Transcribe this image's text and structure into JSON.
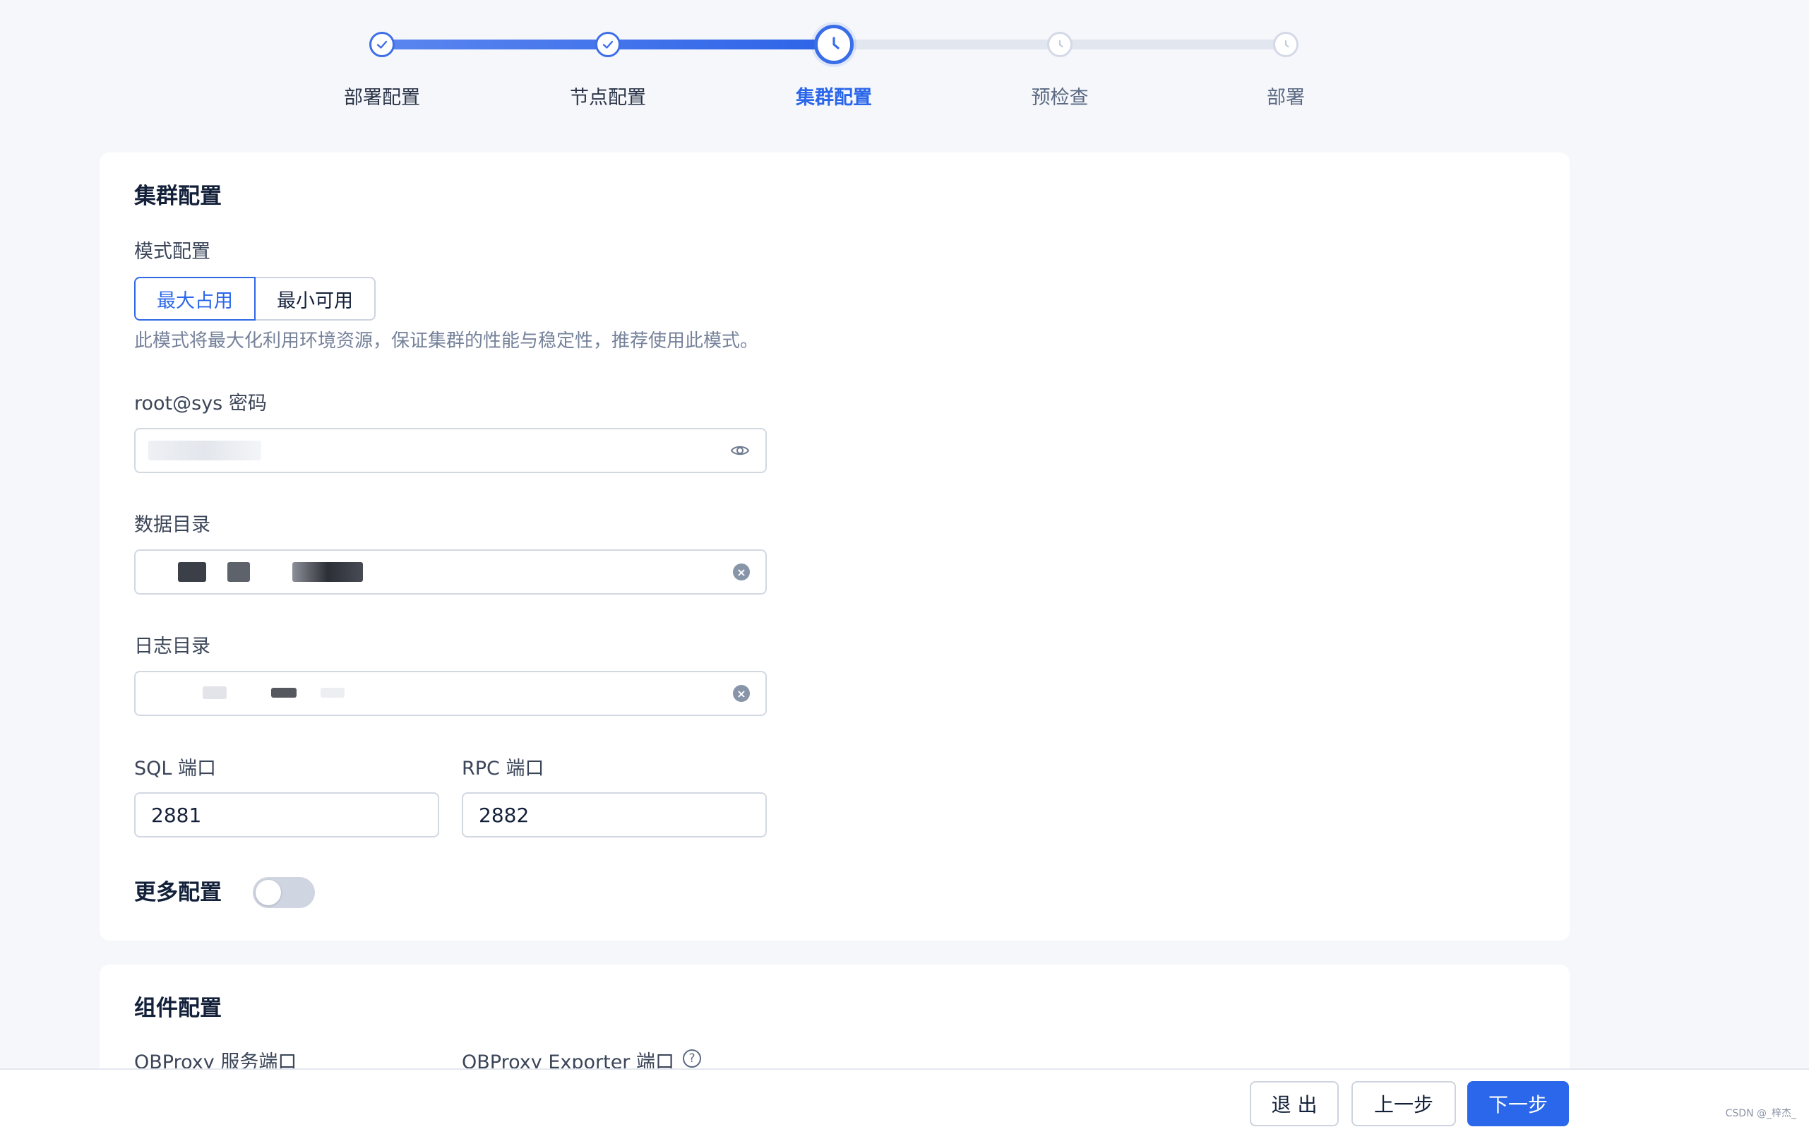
{
  "steps": [
    {
      "label": "部署配置",
      "status": "done"
    },
    {
      "label": "节点配置",
      "status": "done"
    },
    {
      "label": "集群配置",
      "status": "active"
    },
    {
      "label": "预检查",
      "status": "wait"
    },
    {
      "label": "部署",
      "status": "wait"
    }
  ],
  "cluster": {
    "title": "集群配置",
    "mode_label": "模式配置",
    "mode_options": [
      "最大占用",
      "最小可用"
    ],
    "mode_selected": "最大占用",
    "mode_help": "此模式将最大化利用环境资源，保证集群的性能与稳定性，推荐使用此模式。",
    "password_label": "root@sys 密码",
    "data_dir_label": "数据目录",
    "log_dir_label": "日志目录",
    "sql_port_label": "SQL 端口",
    "sql_port_value": "2881",
    "rpc_port_label": "RPC 端口",
    "rpc_port_value": "2882",
    "more_config_label": "更多配置",
    "more_config_enabled": false
  },
  "component": {
    "title": "组件配置",
    "obproxy_port_label": "OBProxy 服务端口",
    "obproxy_exporter_label": "OBProxy Exporter 端口"
  },
  "footer": {
    "exit_label": "退 出",
    "prev_label": "上一步",
    "next_label": "下一步"
  },
  "watermark": "CSDN @_梓杰_",
  "colors": {
    "primary": "#2b67ea",
    "progress_done": "#3f6fe8",
    "progress_wait": "#e1e6ef"
  }
}
